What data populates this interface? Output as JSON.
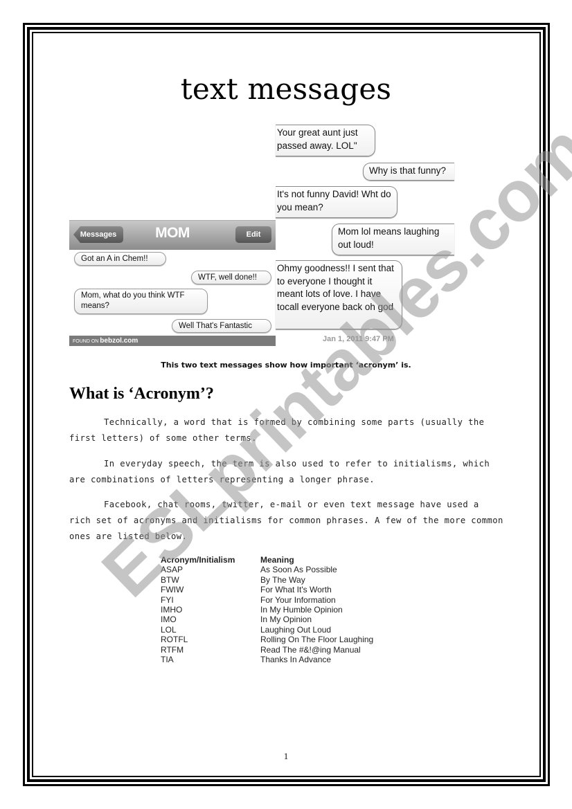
{
  "title": "text messages",
  "phone1": {
    "back_label": "Messages",
    "contact": "MOM",
    "edit_label": "Edit",
    "messages": [
      {
        "side": "left",
        "text": "Got an A in Chem!!"
      },
      {
        "side": "right",
        "text": "WTF, well done!!"
      },
      {
        "side": "left",
        "text": "Mom, what do you think WTF means?"
      },
      {
        "side": "right",
        "text": "Well That's Fantastic"
      }
    ],
    "footer_prefix": "FOUND ON",
    "footer_site": "bebzol.com"
  },
  "phone2": {
    "messages": [
      {
        "side": "left",
        "text": "Your great aunt just passed away. LOL\""
      },
      {
        "side": "right",
        "text": "Why is that funny?"
      },
      {
        "side": "left",
        "text": "It's not funny David! Wht do you mean?"
      },
      {
        "side": "right",
        "text": "Mom lol means laughing out loud!"
      },
      {
        "side": "left",
        "text": "Ohmy goodness!! I sent that to everyone I thought it meant lots of love. I have tocall everyone back oh god"
      }
    ],
    "timestamp": "Jan 1, 2011 9:47 PM"
  },
  "caption": "This two text messages show how important ‘acronym’ is.",
  "heading": "What is ‘Acronym’?",
  "paragraphs": [
    "Technically, a word that is formed by combining some parts (usually the first letters) of some other terms.",
    "In everyday speech, the term is also used to refer to initialisms, which are combinations of letters representing a longer phrase.",
    "Facebook, chat rooms, twitter, e-mail or even text message have used a rich set of acronyms and initialisms for common phrases. A few of the more common ones are listed below."
  ],
  "table": {
    "headers": [
      "Acronym/Initialism",
      "Meaning"
    ],
    "rows": [
      [
        "ASAP",
        "As Soon As Possible"
      ],
      [
        "BTW",
        "By The Way"
      ],
      [
        "FWIW",
        "For What It's Worth"
      ],
      [
        "FYI",
        "For Your Information"
      ],
      [
        "IMHO",
        "In My Humble Opinion"
      ],
      [
        "IMO",
        "In My Opinion"
      ],
      [
        "LOL",
        "Laughing Out Loud"
      ],
      [
        "ROTFL",
        "Rolling On The Floor Laughing"
      ],
      [
        "RTFM",
        "Read The #&!@ing Manual"
      ],
      [
        "TIA",
        "Thanks In Advance"
      ]
    ]
  },
  "page_number": "1",
  "watermark": "ESLprintables.com"
}
